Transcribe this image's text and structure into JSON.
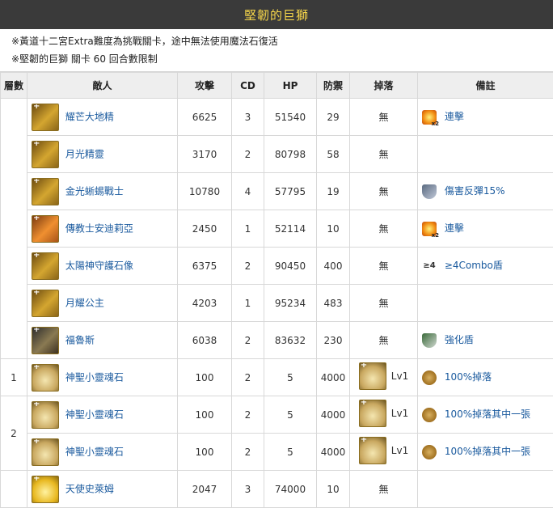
{
  "title": "堅韌的巨獅",
  "notes": [
    "※黃道十二宮Extra難度為挑戰關卡，途中無法使用魔法石復活",
    "※堅韌的巨獅 關卡 60 回合數限制"
  ],
  "headers": [
    "層數",
    "敵人",
    "攻擊",
    "CD",
    "HP",
    "防禦",
    "掉落",
    "備註"
  ],
  "rows": [
    {
      "floor": "",
      "name": "耀芒大地精",
      "atk": "6625",
      "cd": "3",
      "hp": "51540",
      "def": "29",
      "drop": "無",
      "note": "連擊",
      "note_icon": "combo-x2-icon"
    },
    {
      "floor": "",
      "name": "月光精靈",
      "atk": "3170",
      "cd": "2",
      "hp": "80798",
      "def": "58",
      "drop": "無",
      "note": "",
      "note_icon": ""
    },
    {
      "floor": "",
      "name": "金光蜥蜴戰士",
      "atk": "10780",
      "cd": "4",
      "hp": "57795",
      "def": "19",
      "drop": "無",
      "note": "傷害反彈15%",
      "note_icon": "damage-reflect-icon"
    },
    {
      "floor": "",
      "name": "傳教士安迪莉亞",
      "atk": "2450",
      "cd": "1",
      "hp": "52114",
      "def": "10",
      "drop": "無",
      "note": "連擊",
      "note_icon": "combo-x2-icon"
    },
    {
      "floor": "",
      "name": "太陽神守護石像",
      "atk": "6375",
      "cd": "2",
      "hp": "90450",
      "def": "400",
      "drop": "無",
      "note": "≥4Combo盾",
      "note_icon": "combo-shield-4-icon"
    },
    {
      "floor": "",
      "name": "月耀公主",
      "atk": "4203",
      "cd": "1",
      "hp": "95234",
      "def": "483",
      "drop": "無",
      "note": "",
      "note_icon": ""
    },
    {
      "floor": "",
      "name": "福魯斯",
      "atk": "6038",
      "cd": "2",
      "hp": "83632",
      "def": "230",
      "drop": "無",
      "note": "強化盾",
      "note_icon": "enhanced-shield-icon"
    },
    {
      "floor": "1",
      "name": "神聖小靈魂石",
      "atk": "100",
      "cd": "2",
      "hp": "5",
      "def": "4000",
      "drop": "Lv1",
      "note": "100%掉落",
      "note_icon": "drop-icon"
    },
    {
      "floor": "2",
      "name": "神聖小靈魂石",
      "atk": "100",
      "cd": "2",
      "hp": "5",
      "def": "4000",
      "drop": "Lv1",
      "note": "100%掉落其中一張",
      "note_icon": "drop-icon"
    },
    {
      "floor": "",
      "name": "神聖小靈魂石",
      "atk": "100",
      "cd": "2",
      "hp": "5",
      "def": "4000",
      "drop": "Lv1",
      "note": "100%掉落其中一張",
      "note_icon": "drop-icon"
    },
    {
      "floor": "",
      "name": "天使史萊姆",
      "atk": "2047",
      "cd": "3",
      "hp": "74000",
      "def": "10",
      "drop": "無",
      "note": "",
      "note_icon": ""
    }
  ]
}
